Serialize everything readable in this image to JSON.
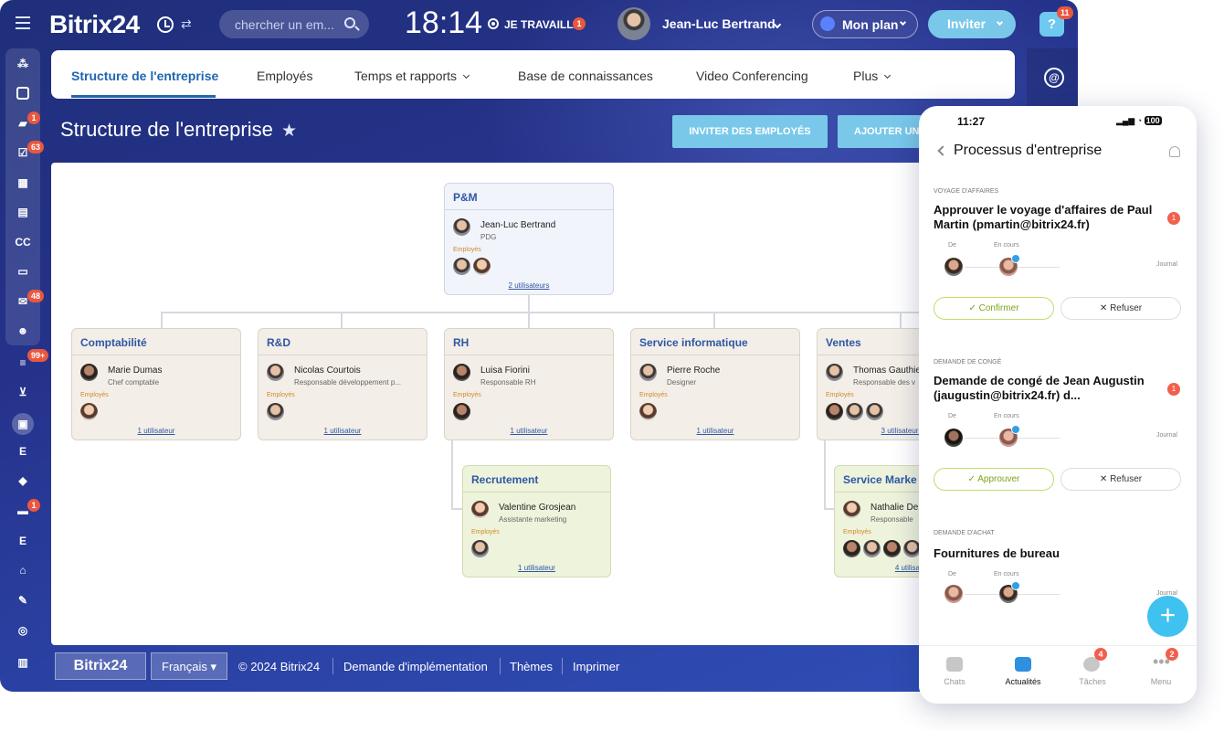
{
  "app": {
    "logo": "Bitrix24",
    "search_placeholder": "chercher un em...",
    "time": "18:14",
    "work_status": "JE TRAVAILLE",
    "work_badge": "1",
    "user_name": "Jean-Luc Bertrand",
    "plan_label": "Mon plan",
    "invite_label": "Inviter",
    "help_badge": "11"
  },
  "sidebar": {
    "badges": {
      "chat": "1",
      "tasks": "63",
      "mail": "48",
      "filter": "99+",
      "robot": "1"
    },
    "letters": {
      "cc": "CC",
      "e1": "E",
      "e2": "E"
    }
  },
  "tabs": [
    {
      "label": "Structure de l'entreprise"
    },
    {
      "label": "Employés"
    },
    {
      "label": "Temps et rapports"
    },
    {
      "label": "Base de connaissances"
    },
    {
      "label": "Video Conferencing"
    },
    {
      "label": "Plus"
    }
  ],
  "page": {
    "title": "Structure de l'entreprise",
    "btn_invite": "INVITER DES EMPLOYÉS",
    "btn_add": "AJOUTER UN"
  },
  "org": {
    "employees_label": "Employés",
    "root": {
      "dept": "P&M",
      "name": "Jean-Luc Bertrand",
      "role": "PDG",
      "link": "2 utilisateurs"
    },
    "depts": [
      {
        "dept": "Comptabilité",
        "name": "Marie Dumas",
        "role": "Chef comptable",
        "link": "1 utilisateur"
      },
      {
        "dept": "R&D",
        "name": "Nicolas Courtois",
        "role": "Responsable développement p...",
        "link": "1 utilisateur"
      },
      {
        "dept": "RH",
        "name": "Luisa Fiorini",
        "role": "Responsable RH",
        "link": "1 utilisateur"
      },
      {
        "dept": "Service informatique",
        "name": "Pierre Roche",
        "role": "Designer",
        "link": "1 utilisateur"
      },
      {
        "dept": "Ventes",
        "name": "Thomas Gauthie",
        "role": "Responsable des v",
        "link": "3 utilisateurs"
      }
    ],
    "sub": [
      {
        "dept": "Recrutement",
        "name": "Valentine Grosjean",
        "role": "Assistante marketing",
        "link": "1 utilisateur"
      },
      {
        "dept": "Service Marke",
        "name": "Nathalie De",
        "role": "Responsable",
        "link": "4 utilisat"
      }
    ]
  },
  "footer": {
    "logo": "Bitrix24",
    "lang": "Français",
    "copyright": "© 2024 Bitrix24",
    "impl": "Demande d'implémentation",
    "themes": "Thèmes",
    "print": "Imprimer"
  },
  "phone": {
    "time": "11:27",
    "battery": "100",
    "title": "Processus d'entreprise",
    "label_from": "De",
    "label_progress": "En cours",
    "label_journal": "Journal",
    "items": [
      {
        "category": "VOYAGE D'AFFAIRES",
        "title": "Approuver le voyage d'affaires de Paul Martin (pmartin@bitrix24.fr)",
        "badge": "1",
        "ok": "Confirmer",
        "no": "Refuser"
      },
      {
        "category": "DEMANDE DE CONGÉ",
        "title": "Demande de congé de Jean Augustin (jaugustin@bitrix24.fr) d...",
        "badge": "1",
        "ok": "Approuver",
        "no": "Refuser"
      },
      {
        "category": "DEMANDE D'ACHAT",
        "title": "Fournitures de bureau"
      }
    ],
    "nav": [
      {
        "label": "Chats"
      },
      {
        "label": "Actualités"
      },
      {
        "label": "Tâches",
        "badge": "4"
      },
      {
        "label": "Menu",
        "badge": "2"
      }
    ]
  }
}
